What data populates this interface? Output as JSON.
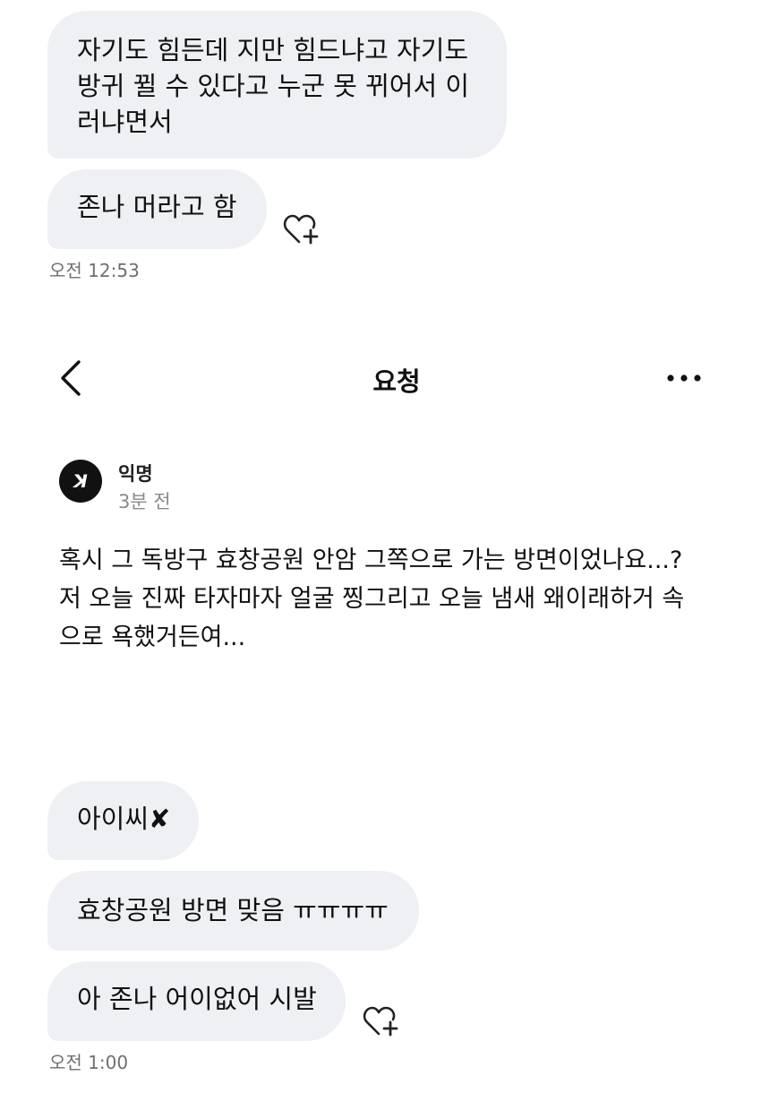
{
  "chat_top": {
    "messages": [
      {
        "lines": [
          "자기도 힘든데 지만 힘드냐고 자기도",
          "방귀 뀔 수 있다고 누군 못 뀌어서 이",
          "러냐면서"
        ]
      },
      {
        "text": "존나 머라고 함"
      }
    ],
    "timestamp": "오전 12:53"
  },
  "header": {
    "title": "요청",
    "back_icon": "chevron-left-icon",
    "more_icon": "ellipsis-icon"
  },
  "post": {
    "author": "익명",
    "time": "3분 전",
    "avatar_glyph": "ꓘ",
    "body_lines": [
      "혹시 그 독방구 효창공원 안암 그쪽으로 가는 방면이었나요...?",
      "저 오늘 진짜 타자마자 얼굴 찡그리고 오늘 냄새 왜이래하거 속",
      "으로 욕했거든여..."
    ]
  },
  "chat_bottom": {
    "messages": [
      {
        "text": "아이씨✘"
      },
      {
        "text": "효창공원 방면 맞음 ㅠㅠㅠㅠ"
      },
      {
        "text": "아 존나 어이없어 시발"
      }
    ],
    "timestamp": "오전 1:00"
  },
  "colors": {
    "bubble_bg": "#eef0f3",
    "text": "#111111",
    "muted": "#6f6f6f"
  }
}
